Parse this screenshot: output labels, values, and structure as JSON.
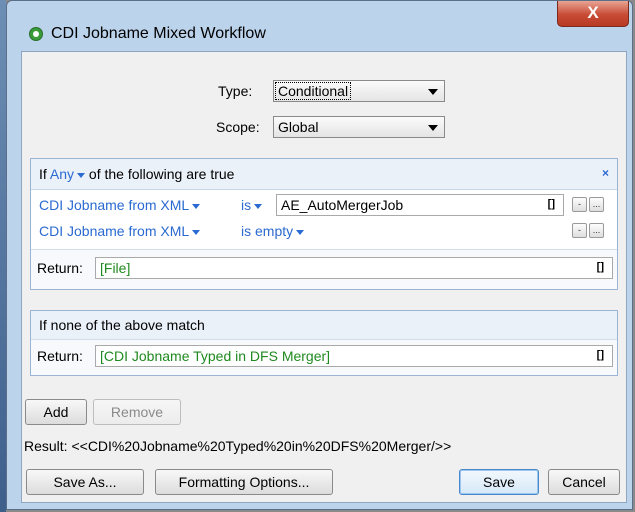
{
  "window": {
    "title": "CDI Jobname Mixed Workflow",
    "close_label": "X"
  },
  "form": {
    "type_label": "Type:",
    "type_value": "Conditional",
    "scope_label": "Scope:",
    "scope_value": "Global"
  },
  "condition": {
    "if_label": "If",
    "any_value": "Any",
    "following_text": "of the following are true",
    "remove_label": "×",
    "rules": [
      {
        "field": "CDI Jobname from XML",
        "operator": "is",
        "value": "AE_AutoMergerJob",
        "bracket": "[]",
        "minus": "-",
        "more": "..."
      },
      {
        "field": "CDI Jobname from XML",
        "operator": "is empty",
        "minus": "-",
        "more": "..."
      }
    ],
    "return_label": "Return:",
    "return_value": "[File]",
    "return_bracket": "[]"
  },
  "fallback": {
    "heading": "If none of the above match",
    "return_label": "Return:",
    "return_value": "[CDI Jobname Typed in DFS Merger]",
    "return_bracket": "[]"
  },
  "actions": {
    "add_label": "Add",
    "remove_label": "Remove"
  },
  "result": {
    "text": "Result: <<CDI%20Jobname%20Typed%20in%20DFS%20Merger/>>"
  },
  "footer": {
    "save_as_label": "Save As...",
    "formatting_label": "Formatting Options...",
    "save_label": "Save",
    "cancel_label": "Cancel"
  }
}
